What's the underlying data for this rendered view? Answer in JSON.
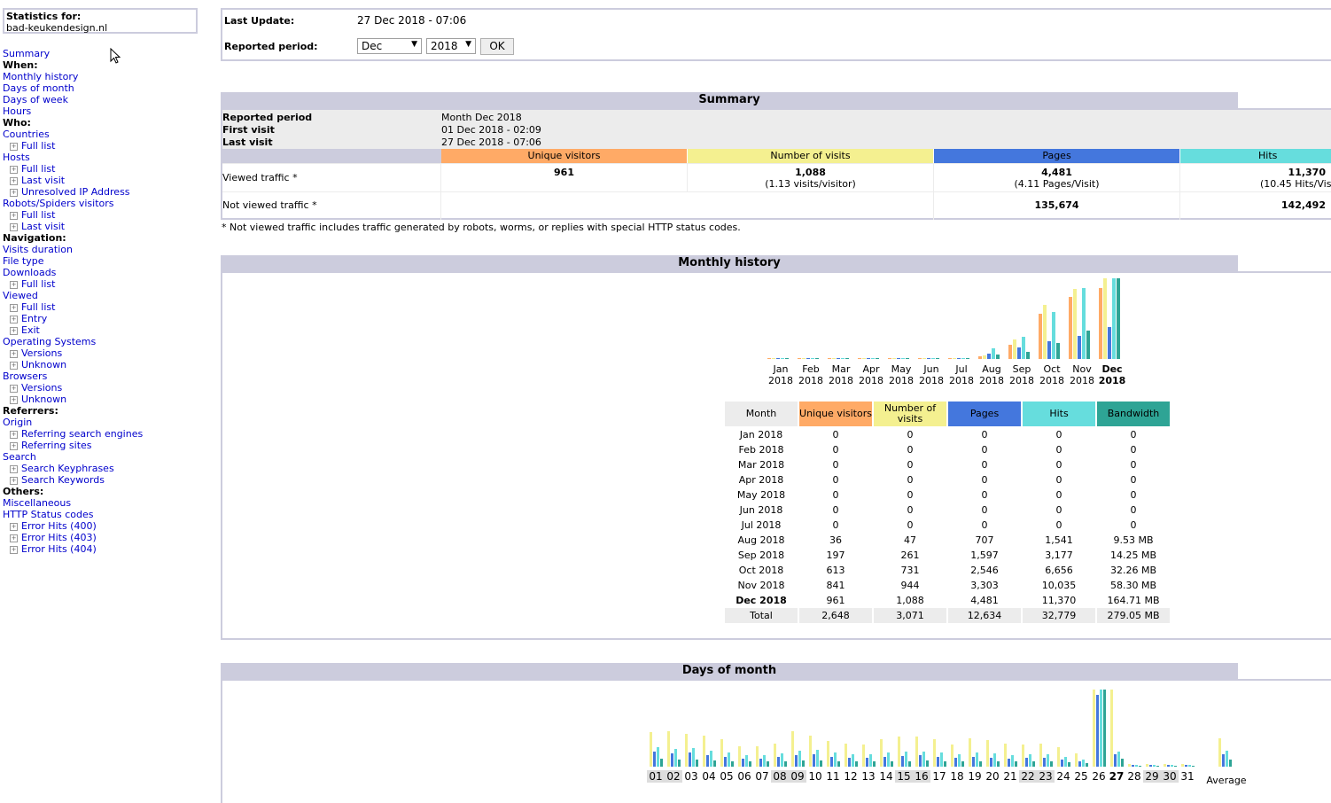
{
  "sidebar": {
    "stats_label": "Statistics for:",
    "site": "bad-keukendesign.nl",
    "items": [
      {
        "type": "link",
        "label": "Summary",
        "name": "menu-summary"
      },
      {
        "type": "head",
        "label": "When:",
        "name": "menu-head-when"
      },
      {
        "type": "link",
        "label": "Monthly history",
        "name": "menu-monthly-history"
      },
      {
        "type": "link",
        "label": "Days of month",
        "name": "menu-days-of-month"
      },
      {
        "type": "link",
        "label": "Days of week",
        "name": "menu-days-of-week"
      },
      {
        "type": "link",
        "label": "Hours",
        "name": "menu-hours"
      },
      {
        "type": "head",
        "label": "Who:",
        "name": "menu-head-who"
      },
      {
        "type": "link",
        "label": "Countries",
        "name": "menu-countries"
      },
      {
        "type": "sub",
        "label": "Full list",
        "name": "menu-countries-full-list"
      },
      {
        "type": "link",
        "label": "Hosts",
        "name": "menu-hosts"
      },
      {
        "type": "sub",
        "label": "Full list",
        "name": "menu-hosts-full-list"
      },
      {
        "type": "sub",
        "label": "Last visit",
        "name": "menu-hosts-last-visit"
      },
      {
        "type": "sub",
        "label": "Unresolved IP Address",
        "name": "menu-unresolved-ip"
      },
      {
        "type": "link",
        "label": "Robots/Spiders visitors",
        "name": "menu-robots"
      },
      {
        "type": "sub",
        "label": "Full list",
        "name": "menu-robots-full-list"
      },
      {
        "type": "sub",
        "label": "Last visit",
        "name": "menu-robots-last-visit"
      },
      {
        "type": "head",
        "label": "Navigation:",
        "name": "menu-head-navigation"
      },
      {
        "type": "link",
        "label": "Visits duration",
        "name": "menu-visits-duration"
      },
      {
        "type": "link",
        "label": "File type",
        "name": "menu-file-type"
      },
      {
        "type": "link",
        "label": "Downloads",
        "name": "menu-downloads"
      },
      {
        "type": "sub",
        "label": "Full list",
        "name": "menu-downloads-full-list"
      },
      {
        "type": "link",
        "label": "Viewed",
        "name": "menu-viewed"
      },
      {
        "type": "sub",
        "label": "Full list",
        "name": "menu-viewed-full-list"
      },
      {
        "type": "sub",
        "label": "Entry",
        "name": "menu-viewed-entry"
      },
      {
        "type": "sub",
        "label": "Exit",
        "name": "menu-viewed-exit"
      },
      {
        "type": "link",
        "label": "Operating Systems",
        "name": "menu-os"
      },
      {
        "type": "sub",
        "label": "Versions",
        "name": "menu-os-versions"
      },
      {
        "type": "sub",
        "label": "Unknown",
        "name": "menu-os-unknown"
      },
      {
        "type": "link",
        "label": "Browsers",
        "name": "menu-browsers"
      },
      {
        "type": "sub",
        "label": "Versions",
        "name": "menu-browsers-versions"
      },
      {
        "type": "sub",
        "label": "Unknown",
        "name": "menu-browsers-unknown"
      },
      {
        "type": "head",
        "label": "Referrers:",
        "name": "menu-head-referrers"
      },
      {
        "type": "link",
        "label": "Origin",
        "name": "menu-origin"
      },
      {
        "type": "sub",
        "label": "Referring search engines",
        "name": "menu-referring-search-engines"
      },
      {
        "type": "sub",
        "label": "Referring sites",
        "name": "menu-referring-sites"
      },
      {
        "type": "link",
        "label": "Search",
        "name": "menu-search"
      },
      {
        "type": "sub",
        "label": "Search Keyphrases",
        "name": "menu-search-keyphrases"
      },
      {
        "type": "sub",
        "label": "Search Keywords",
        "name": "menu-search-keywords"
      },
      {
        "type": "head",
        "label": "Others:",
        "name": "menu-head-others"
      },
      {
        "type": "link",
        "label": "Miscellaneous",
        "name": "menu-miscellaneous"
      },
      {
        "type": "link",
        "label": "HTTP Status codes",
        "name": "menu-http-status"
      },
      {
        "type": "sub",
        "label": "Error Hits (400)",
        "name": "menu-error-400"
      },
      {
        "type": "sub",
        "label": "Error Hits (403)",
        "name": "menu-error-403"
      },
      {
        "type": "sub",
        "label": "Error Hits (404)",
        "name": "menu-error-404"
      }
    ]
  },
  "top": {
    "last_update_label": "Last Update:",
    "last_update_value": "27 Dec 2018 - 07:06",
    "period_label": "Reported period:",
    "month_selected": "Dec",
    "year_selected": "2018",
    "ok_label": "OK"
  },
  "summary": {
    "title": "Summary",
    "reported_period_label": "Reported period",
    "reported_period_value": "Month Dec 2018",
    "first_visit_label": "First visit",
    "first_visit_value": "01 Dec 2018 - 02:09",
    "last_visit_label": "Last visit",
    "last_visit_value": "27 Dec 2018 - 07:06",
    "col_visitors": "Unique visitors",
    "col_visits": "Number of visits",
    "col_pages": "Pages",
    "col_hits": "Hits",
    "viewed_label": "Viewed traffic *",
    "viewed_visitors": "961",
    "viewed_visits": "1,088",
    "viewed_visits_sub": "(1.13 visits/visitor)",
    "viewed_pages": "4,481",
    "viewed_pages_sub": "(4.11 Pages/Visit)",
    "viewed_hits": "11,370",
    "viewed_hits_sub": "(10.45 Hits/Vis",
    "not_viewed_label": "Not viewed traffic *",
    "not_viewed_pages": "135,674",
    "not_viewed_hits": "142,492",
    "footnote": "* Not viewed traffic includes traffic generated by robots, worms, or replies with special HTTP status codes."
  },
  "monthly": {
    "title": "Monthly history",
    "headers": [
      "Month",
      "Unique visitors",
      "Number of visits",
      "Pages",
      "Hits",
      "Bandwidth"
    ],
    "rows": [
      [
        "Jan 2018",
        "0",
        "0",
        "0",
        "0",
        "0"
      ],
      [
        "Feb 2018",
        "0",
        "0",
        "0",
        "0",
        "0"
      ],
      [
        "Mar 2018",
        "0",
        "0",
        "0",
        "0",
        "0"
      ],
      [
        "Apr 2018",
        "0",
        "0",
        "0",
        "0",
        "0"
      ],
      [
        "May 2018",
        "0",
        "0",
        "0",
        "0",
        "0"
      ],
      [
        "Jun 2018",
        "0",
        "0",
        "0",
        "0",
        "0"
      ],
      [
        "Jul 2018",
        "0",
        "0",
        "0",
        "0",
        "0"
      ],
      [
        "Aug 2018",
        "36",
        "47",
        "707",
        "1,541",
        "9.53 MB"
      ],
      [
        "Sep 2018",
        "197",
        "261",
        "1,597",
        "3,177",
        "14.25 MB"
      ],
      [
        "Oct 2018",
        "613",
        "731",
        "2,546",
        "6,656",
        "32.26 MB"
      ],
      [
        "Nov 2018",
        "841",
        "944",
        "3,303",
        "10,035",
        "58.30 MB"
      ],
      [
        "Dec 2018",
        "961",
        "1,088",
        "4,481",
        "11,370",
        "164.71 MB"
      ]
    ],
    "total": [
      "Total",
      "2,648",
      "3,071",
      "12,634",
      "32,779",
      "279.05 MB"
    ],
    "colors": {
      "visitors": "#ffaa66",
      "visits": "#f4f090",
      "pages": "#4477dd",
      "hits": "#66dddd",
      "bandwidth": "#2ea495"
    }
  },
  "chart_data": [
    {
      "type": "bar",
      "categories": [
        "Jan 2018",
        "Feb 2018",
        "Mar 2018",
        "Apr 2018",
        "May 2018",
        "Jun 2018",
        "Jul 2018",
        "Aug 2018",
        "Sep 2018",
        "Oct 2018",
        "Nov 2018",
        "Dec 2018"
      ],
      "series": [
        {
          "name": "Unique visitors",
          "values": [
            0,
            0,
            0,
            0,
            0,
            0,
            0,
            36,
            197,
            613,
            841,
            961
          ]
        },
        {
          "name": "Number of visits",
          "values": [
            0,
            0,
            0,
            0,
            0,
            0,
            0,
            47,
            261,
            731,
            944,
            1088
          ]
        },
        {
          "name": "Pages",
          "values": [
            0,
            0,
            0,
            0,
            0,
            0,
            0,
            707,
            1597,
            2546,
            3303,
            4481
          ]
        },
        {
          "name": "Hits",
          "values": [
            0,
            0,
            0,
            0,
            0,
            0,
            0,
            1541,
            3177,
            6656,
            10035,
            11370
          ]
        },
        {
          "name": "Bandwidth",
          "values": [
            0,
            0,
            0,
            0,
            0,
            0,
            0,
            9.53,
            14.25,
            32.26,
            58.3,
            164.71
          ]
        }
      ],
      "labels": [
        [
          "Jan",
          "2018"
        ],
        [
          "Feb",
          "2018"
        ],
        [
          "Mar",
          "2018"
        ],
        [
          "Apr",
          "2018"
        ],
        [
          "May",
          "2018"
        ],
        [
          "Jun",
          "2018"
        ],
        [
          "Jul",
          "2018"
        ],
        [
          "Aug",
          "2018"
        ],
        [
          "Sep",
          "2018"
        ],
        [
          "Oct",
          "2018"
        ],
        [
          "Nov",
          "2018"
        ],
        [
          "Dec",
          "2018"
        ]
      ]
    },
    {
      "type": "bar",
      "categories": [
        "01",
        "02",
        "03",
        "04",
        "05",
        "06",
        "07",
        "08",
        "09",
        "10",
        "11",
        "12",
        "13",
        "14",
        "15",
        "16",
        "17",
        "18",
        "19",
        "20",
        "21",
        "22",
        "23",
        "24",
        "25",
        "26",
        "27",
        "28",
        "29",
        "30",
        "31",
        "Average"
      ],
      "series": [
        {
          "name": "Number of visits",
          "values": [
            42,
            44,
            40,
            38,
            34,
            25,
            25,
            28,
            44,
            38,
            32,
            28,
            27,
            34,
            37,
            37,
            34,
            27,
            35,
            33,
            28,
            27,
            28,
            24,
            16,
            95,
            95,
            3,
            3,
            3,
            3,
            35
          ]
        },
        {
          "name": "Pages",
          "values": [
            18,
            16,
            17,
            14,
            12,
            10,
            10,
            12,
            14,
            15,
            12,
            11,
            11,
            12,
            13,
            14,
            12,
            11,
            12,
            11,
            10,
            11,
            11,
            9,
            7,
            88,
            15,
            2,
            2,
            2,
            2,
            15
          ]
        },
        {
          "name": "Hits",
          "values": [
            24,
            22,
            23,
            20,
            17,
            14,
            14,
            16,
            20,
            21,
            17,
            15,
            15,
            17,
            18,
            19,
            17,
            15,
            17,
            16,
            14,
            15,
            15,
            12,
            9,
            95,
            18,
            2,
            2,
            2,
            2,
            20
          ]
        },
        {
          "name": "Bandwidth",
          "values": [
            10,
            9,
            9,
            8,
            7,
            6,
            6,
            7,
            8,
            8,
            7,
            6,
            6,
            7,
            7,
            8,
            7,
            6,
            7,
            6,
            6,
            6,
            6,
            5,
            4,
            95,
            10,
            1,
            1,
            1,
            1,
            9
          ]
        }
      ]
    }
  ],
  "days_of_month": {
    "title": "Days of month",
    "average_label": "Average"
  }
}
